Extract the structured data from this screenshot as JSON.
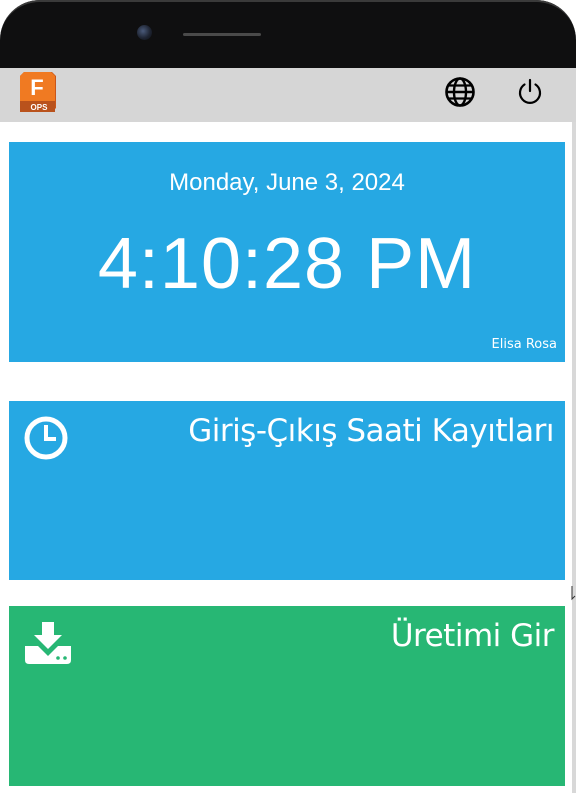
{
  "app": {
    "logo_letter": "F",
    "logo_caption": "OPS"
  },
  "header": {
    "language_icon": "globe-icon",
    "logout_icon": "power-icon"
  },
  "clock": {
    "date": "Monday, June 3, 2024",
    "time": "4:10:28 PM",
    "user": "Elisa Rosa"
  },
  "tiles": [
    {
      "title": "Giriş-Çıkış Saati Kayıtları",
      "icon": "clock-icon",
      "color": "#26a8e3"
    },
    {
      "title": "Üretimi Gir",
      "icon": "download-icon",
      "color": "#27b774"
    }
  ],
  "colors": {
    "appbar": "#d6d6d6",
    "primary": "#26a8e3",
    "success": "#27b774",
    "logo": "#e8641b"
  }
}
